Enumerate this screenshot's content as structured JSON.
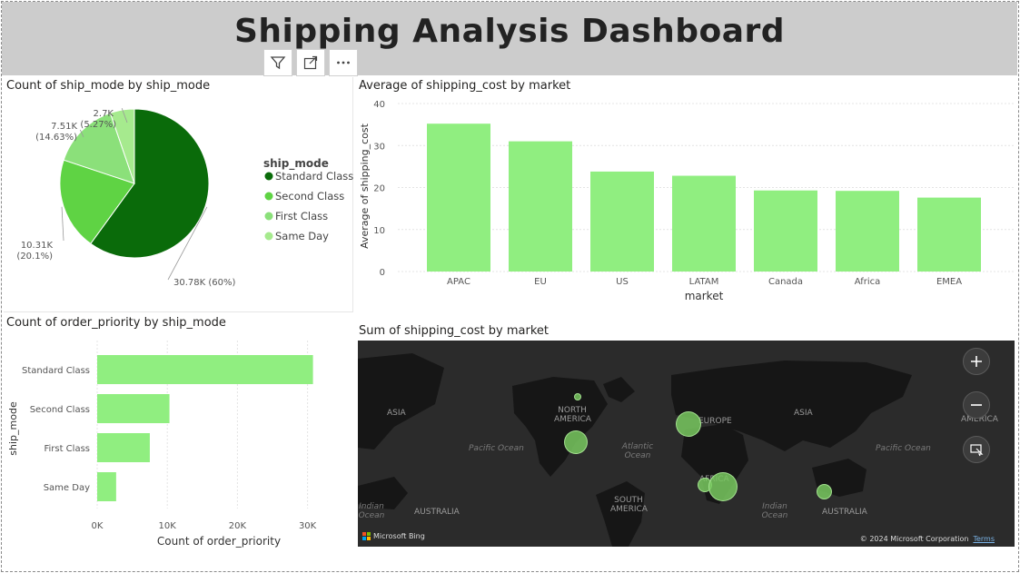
{
  "dashboard": {
    "title": "Shipping Analysis Dashboard"
  },
  "toolbar": {
    "icons": [
      "filter-icon",
      "focus-mode-icon",
      "more-options-icon"
    ]
  },
  "colors": {
    "dark": "#0a6b0a",
    "medium": "#5fd344",
    "light": "#8be07a",
    "lighter": "#a6ea8e",
    "bar": "#90ee80"
  },
  "pie": {
    "title": "Count of ship_mode by ship_mode",
    "legend_title": "ship_mode",
    "chart_data": {
      "type": "pie",
      "categories": [
        "Standard Class",
        "Second Class",
        "First Class",
        "Same Day"
      ],
      "values": [
        30.78,
        10.31,
        7.51,
        2.7
      ],
      "value_labels": [
        "30.78K (60%)",
        "10.31K",
        "7.51K",
        "2.7K"
      ],
      "percent_labels": [
        "",
        "(20.1%)",
        "(14.63%)",
        "(5.27%)"
      ],
      "unit": "K"
    }
  },
  "avgbar": {
    "title": "Average of shipping_cost by market",
    "chart_data": {
      "type": "bar",
      "categories": [
        "APAC",
        "EU",
        "US",
        "LATAM",
        "Canada",
        "Africa",
        "EMEA"
      ],
      "values": [
        35.2,
        31.0,
        23.8,
        22.8,
        19.3,
        19.2,
        17.6
      ],
      "xlabel": "market",
      "ylabel": "Average of shipping_cost",
      "ylim": [
        0,
        40
      ],
      "yticks": [
        "0",
        "10",
        "20",
        "30",
        "40"
      ],
      "grid": true
    }
  },
  "hbar": {
    "title": "Count of order_priority by ship_mode",
    "chart_data": {
      "type": "bar",
      "orientation": "horizontal",
      "categories": [
        "Standard Class",
        "Second Class",
        "First Class",
        "Same Day"
      ],
      "values": [
        30775,
        10309,
        7505,
        2701
      ],
      "xlabel": "Count of order_priority",
      "ylabel": "ship_mode",
      "xlim": [
        0,
        30000
      ],
      "xticks": [
        "0K",
        "10K",
        "20K",
        "30K"
      ],
      "grid": true
    }
  },
  "map": {
    "title": "Sum of shipping_cost by market",
    "continents": [
      "ASIA",
      "NORTH AMERICA",
      "EUROPE",
      "ASIA",
      "AMERICA",
      "AFRICA",
      "SOUTH AMERICA",
      "AUSTRALIA",
      "AUSTRALIA"
    ],
    "oceans": [
      "Pacific Ocean",
      "Atlantic Ocean",
      "Pacific Ocean",
      "Indian Ocean",
      "Indian Ocean"
    ],
    "attribution": "Microsoft Bing",
    "copyright": "© 2024 Microsoft Corporation",
    "terms": "Terms",
    "controls": [
      "zoom-in-icon",
      "zoom-out-icon",
      "select-icon"
    ]
  }
}
